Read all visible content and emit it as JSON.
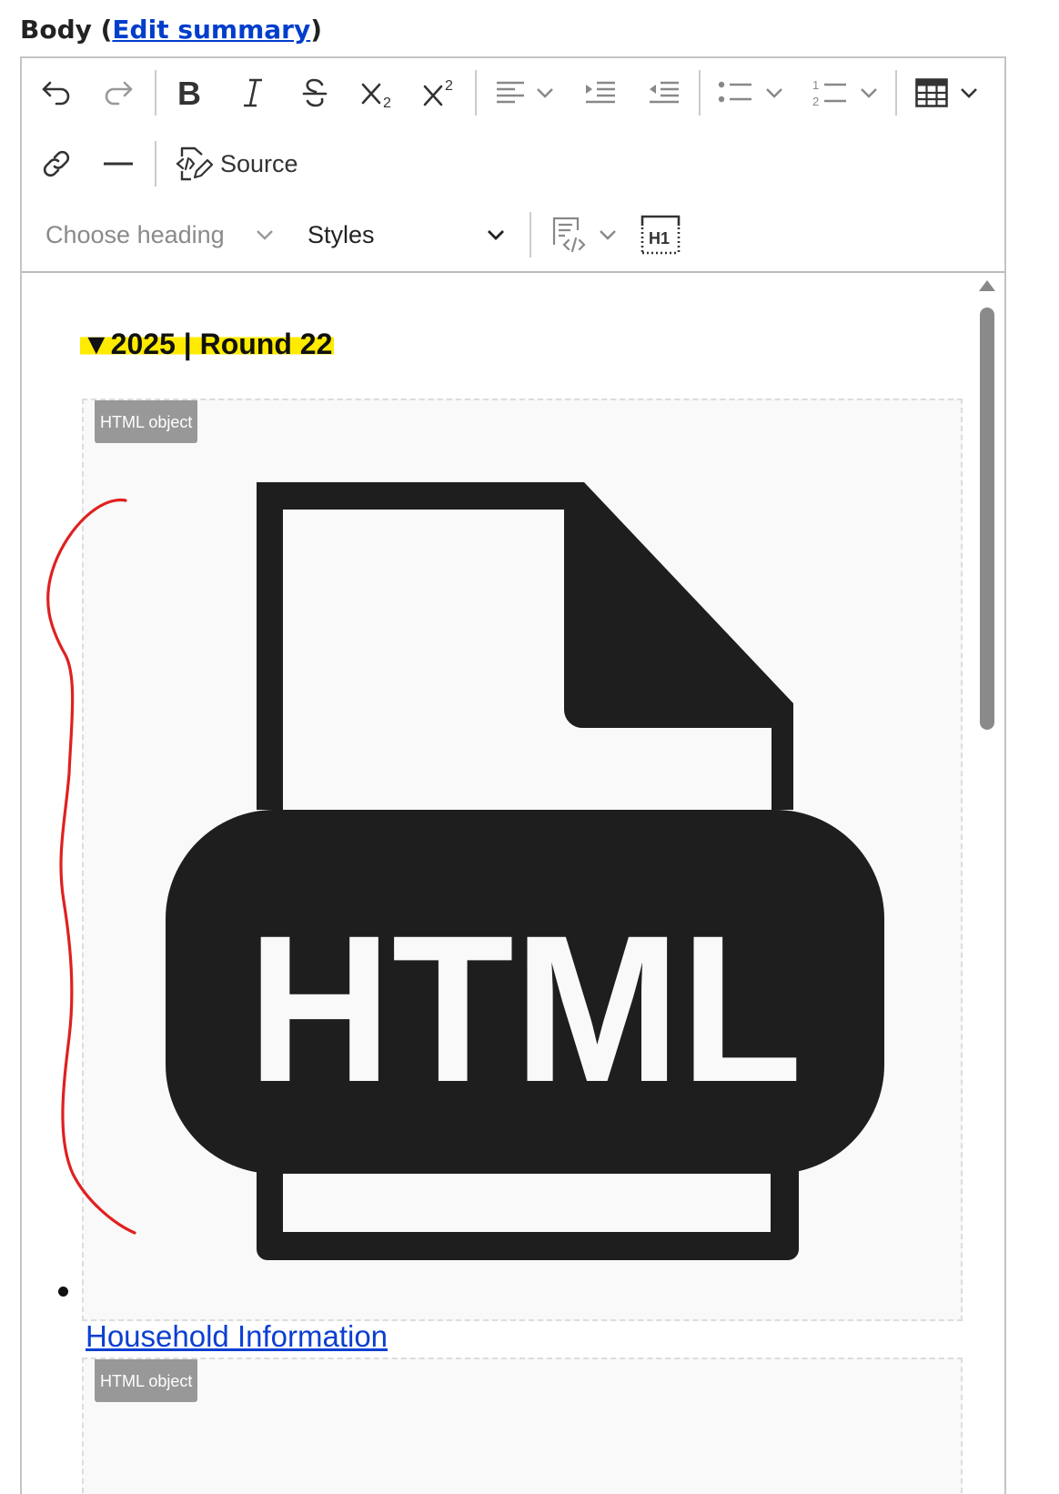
{
  "field": {
    "label_prefix": "Body (",
    "edit_summary_link": "Edit summary",
    "label_suffix": ")"
  },
  "toolbar": {
    "buttons": [
      {
        "name": "undo",
        "icon": "undo-icon"
      },
      {
        "name": "redo",
        "icon": "redo-icon"
      },
      {
        "name": "bold",
        "icon": "bold-icon"
      },
      {
        "name": "italic",
        "icon": "italic-icon"
      },
      {
        "name": "strikethrough",
        "icon": "strikethrough-icon"
      },
      {
        "name": "subscript",
        "icon": "subscript-icon"
      },
      {
        "name": "superscript",
        "icon": "superscript-icon"
      },
      {
        "name": "text-alignment",
        "icon": "align-left-icon"
      },
      {
        "name": "indent",
        "icon": "indent-icon"
      },
      {
        "name": "outdent",
        "icon": "outdent-icon"
      },
      {
        "name": "bulleted-list",
        "icon": "bulleted-list-icon"
      },
      {
        "name": "numbered-list",
        "icon": "numbered-list-icon"
      },
      {
        "name": "insert-table",
        "icon": "table-icon"
      },
      {
        "name": "link",
        "icon": "link-icon"
      },
      {
        "name": "horizontal-line",
        "icon": "horizontal-line-icon"
      },
      {
        "name": "code-block",
        "icon": "code-block-icon"
      },
      {
        "name": "show-blocks",
        "icon": "show-blocks-icon"
      }
    ],
    "source_label": "Source",
    "heading_placeholder": "Choose heading",
    "styles_label": "Styles",
    "show_blocks_label": "H1"
  },
  "content": {
    "summary_marker": "▼",
    "summary_text": "2025 | Round 22",
    "html_object_badge": "HTML object",
    "html_icon_text": "HTML",
    "list_link": "Household Information",
    "second_object_badge": "HTML object"
  },
  "colors": {
    "link": "#0b3fd1",
    "highlight": "#ffeb00",
    "annotation": "#e02020",
    "icon_fill": "#1e1e1e"
  }
}
